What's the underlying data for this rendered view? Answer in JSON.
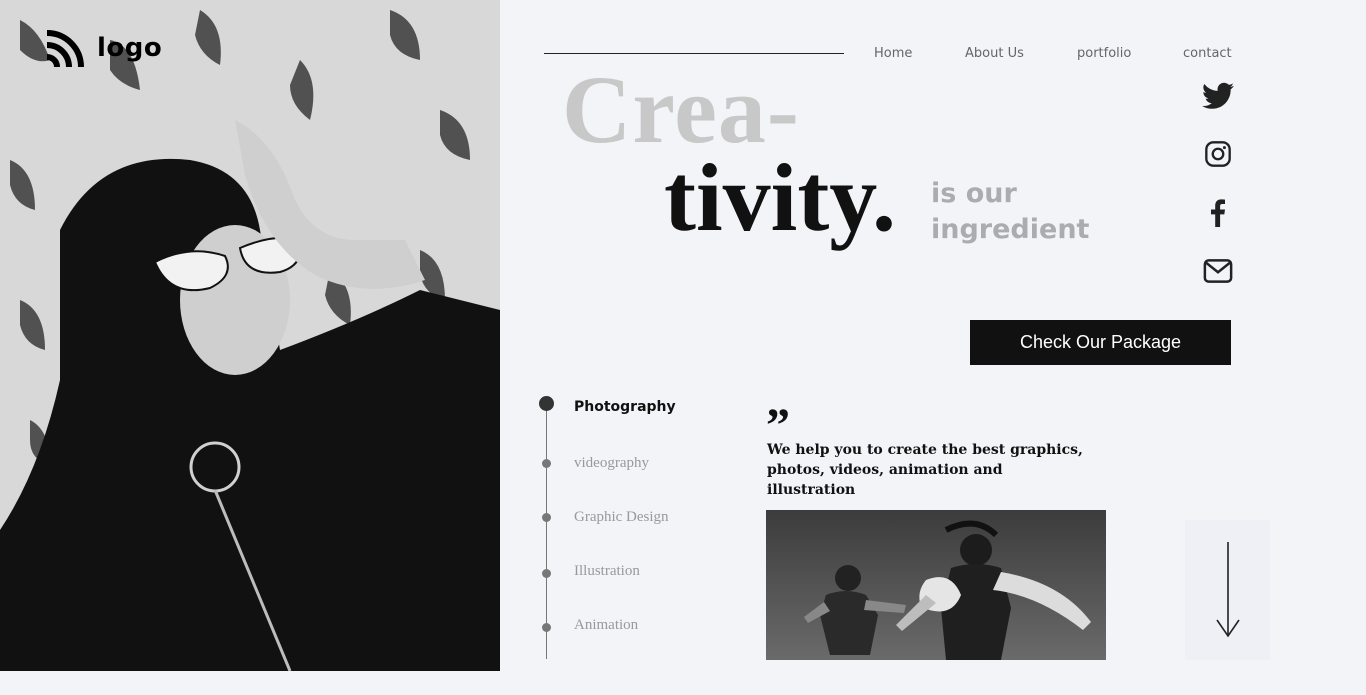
{
  "logo": {
    "text": "logo"
  },
  "nav": {
    "items": [
      {
        "label": "Home"
      },
      {
        "label": "About Us"
      },
      {
        "label": "portfolio"
      },
      {
        "label": "contact"
      }
    ]
  },
  "hero": {
    "line1": "Crea-",
    "line2": "tivity.",
    "tagline": "is our ingredient"
  },
  "social": [
    "twitter-icon",
    "instagram-icon",
    "facebook-icon",
    "mail-icon"
  ],
  "cta": {
    "label": "Check Our Package"
  },
  "services": [
    {
      "label": "Photography",
      "active": true
    },
    {
      "label": "videography"
    },
    {
      "label": "Graphic Design"
    },
    {
      "label": "Illustration"
    },
    {
      "label": "Animation"
    }
  ],
  "quote": {
    "mark": "”",
    "text": "We help you to create the best graphics, photos, videos, animation and illustration"
  },
  "colors": {
    "accent": "#111111",
    "muted": "#a9adae",
    "background": "#f3f4f8"
  }
}
